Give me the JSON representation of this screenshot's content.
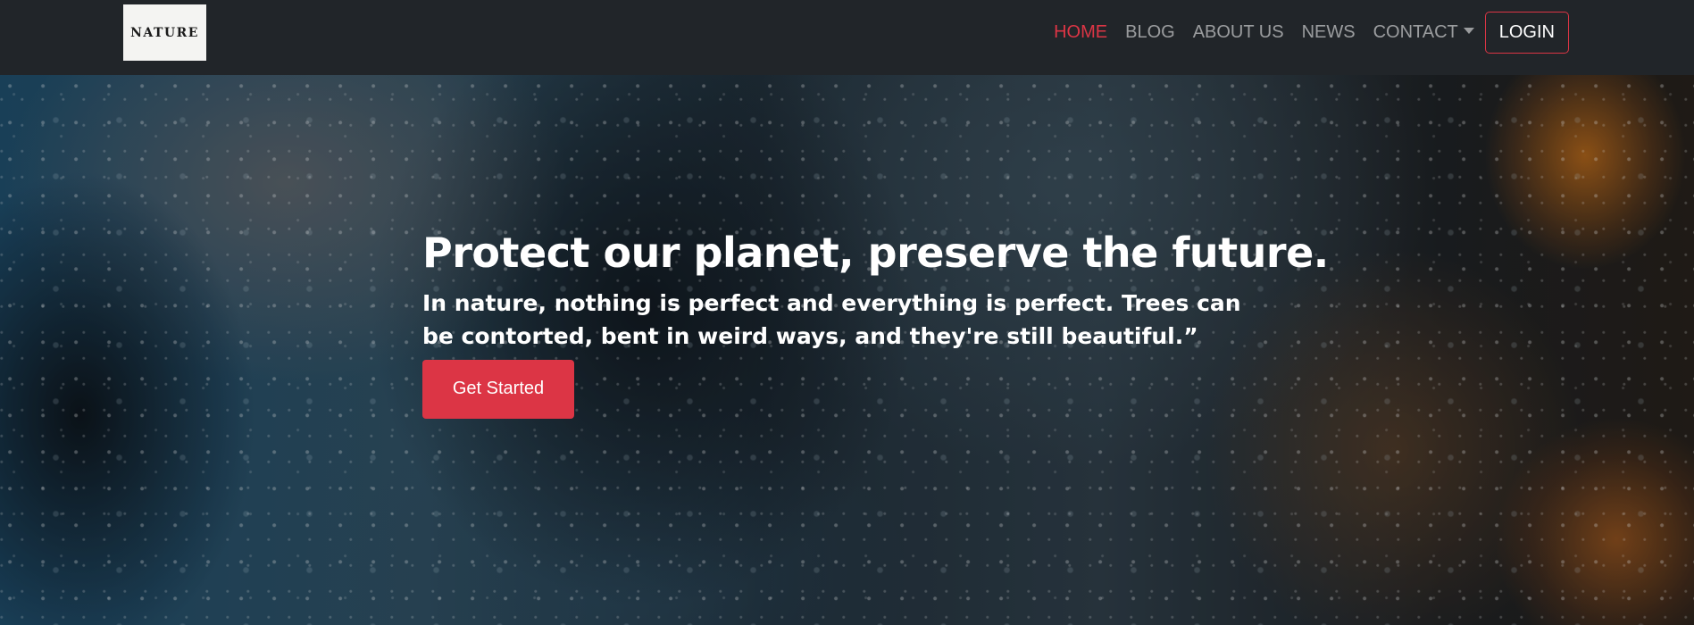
{
  "navbar": {
    "logo_text": "NATURE",
    "links": [
      {
        "label": "HOME",
        "active": true
      },
      {
        "label": "BLOG",
        "active": false
      },
      {
        "label": "ABOUT US",
        "active": false
      },
      {
        "label": "NEWS",
        "active": false
      },
      {
        "label": "CONTACT",
        "active": false,
        "dropdown": true
      }
    ],
    "login_label": "LOGIN"
  },
  "hero": {
    "title": "Protect our planet, preserve the future.",
    "subtitle": "In nature, nothing is perfect and everything is perfect. Trees can be contorted, bent in weird ways, and they're still beautiful.”",
    "cta_label": "Get Started",
    "background": "rain-drops-on-glass-photo"
  },
  "colors": {
    "navbar_bg": "#212529",
    "accent": "#dc3545",
    "nav_link": "rgba(255,255,255,0.55)",
    "text": "#ffffff"
  }
}
